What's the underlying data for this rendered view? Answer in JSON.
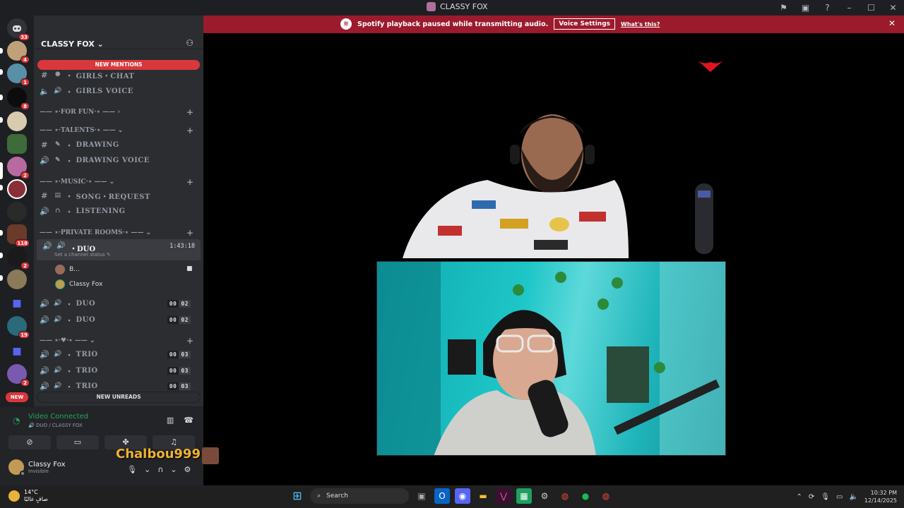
{
  "window": {
    "title": "CLASSY FOX"
  },
  "notice": {
    "text": "Spotify playback paused while transmitting audio.",
    "button": "Voice Settings",
    "link": "What's this?"
  },
  "servers": {
    "badges": [
      "33",
      "4",
      "1",
      "8",
      "2",
      "118",
      "2",
      "19",
      "2"
    ],
    "new_label": "NEW"
  },
  "guild": {
    "name": "CLASSY FOX",
    "new_mentions": "NEW MENTIONS",
    "new_unreads": "NEW UNREADS"
  },
  "channels": {
    "girls_chat": "GIRLS・CHAT",
    "girls_voice": "GIRLS VOICE",
    "cat_fun": "FOR FUN",
    "cat_talents": "TALENTS",
    "drawing": "DRAWING",
    "drawing_voice": "DRAWING VOICE",
    "cat_music": "MUSIC",
    "song_request": "SONG・REQUEST",
    "listening": "LISTENING",
    "cat_private": "PRIVATE ROOMS",
    "duo_active": "DUO",
    "duo_time": "1:43:18",
    "duo_status": "Set a channel status",
    "member1": "B...",
    "member2": "Classy Fox",
    "duo2": "DUO",
    "duo3": "DUO",
    "duo_counts": [
      "00",
      "02"
    ],
    "trio1": "TRIO",
    "trio2": "TRIO",
    "trio3": "TRIO",
    "trio_counts": [
      "00",
      "03"
    ]
  },
  "voice": {
    "status": "Video Connected",
    "channel": "DUO / CLASSY FOX"
  },
  "user": {
    "name": "Classy Fox",
    "status": "Invisible"
  },
  "overlay": {
    "name": "Chalbou999"
  },
  "taskbar": {
    "temp": "14°C",
    "weather": "صافٍ غالبًا",
    "search": "Search",
    "time": "10:32 PM",
    "date": "12/14/2025"
  },
  "colors": {
    "accent_red": "#da373c",
    "connected_green": "#23a55a",
    "notice_bg": "#9b1b2c"
  }
}
